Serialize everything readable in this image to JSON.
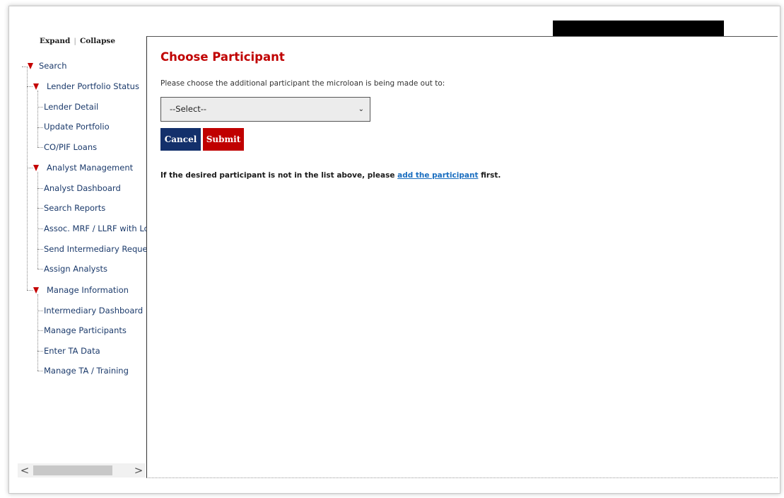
{
  "sidebar": {
    "expand_label": "Expand",
    "separator": "|",
    "collapse_label": "Collapse",
    "tree": {
      "search": "Search",
      "lender_portfolio_status": "Lender Portfolio Status",
      "lender_detail": "Lender Detail",
      "update_portfolio": "Update Portfolio",
      "co_pif_loans": "CO/PIF Loans",
      "analyst_management": "Analyst Management",
      "analyst_dashboard": "Analyst Dashboard",
      "search_reports": "Search Reports",
      "assoc_mrf": "Assoc. MRF / LLRF with Loan",
      "send_intermediary_requests": "Send Intermediary Requests",
      "assign_analysts": "Assign Analysts",
      "manage_information": "Manage Information",
      "intermediary_dashboard": "Intermediary Dashboard",
      "manage_participants": "Manage Participants",
      "enter_ta_data": "Enter TA Data",
      "manage_ta_training": "Manage TA / Training"
    },
    "scroll_left": "<",
    "scroll_right": ">"
  },
  "main": {
    "title": "Choose Participant",
    "instruction": "Please choose the additional participant the microloan is being made out to:",
    "select_value": "--Select--",
    "select_caret": "⌄",
    "cancel_label": "Cancel",
    "submit_label": "Submit",
    "note_prefix": "If the desired participant is not in the list above, please ",
    "note_link": "add the participant",
    "note_suffix": " first."
  },
  "colors": {
    "title_red": "#c00000",
    "cancel_navy": "#13306b",
    "submit_red": "#c00000",
    "link_blue": "#1a6ec0",
    "tree_triangle": "#c40000"
  }
}
